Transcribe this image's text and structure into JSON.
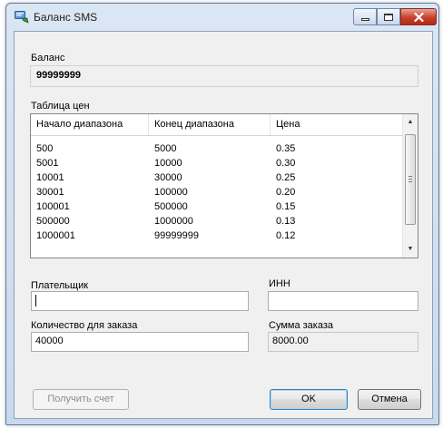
{
  "window": {
    "title": "Баланс SMS"
  },
  "balance": {
    "label": "Баланс",
    "value": "99999999"
  },
  "price_table": {
    "label": "Таблица цен",
    "columns": [
      "Начало диапазона",
      "Конец диапазона",
      "Цена"
    ],
    "rows": [
      [
        "500",
        "5000",
        "0.35"
      ],
      [
        "5001",
        "10000",
        "0.30"
      ],
      [
        "10001",
        "30000",
        "0.25"
      ],
      [
        "30001",
        "100000",
        "0.20"
      ],
      [
        "100001",
        "500000",
        "0.15"
      ],
      [
        "500000",
        "1000000",
        "0.13"
      ],
      [
        "1000001",
        "99999999",
        "0.12"
      ]
    ]
  },
  "payer": {
    "label": "Плательщик",
    "value": ""
  },
  "inn": {
    "label": "ИНН",
    "value": ""
  },
  "quantity": {
    "label": "Количество для заказа",
    "value": "40000"
  },
  "order_sum": {
    "label": "Сумма заказа",
    "value": "8000.00"
  },
  "buttons": {
    "get_invoice": "Получить счет",
    "ok": "OK",
    "cancel": "Отмена"
  },
  "icons": {
    "app": "sms-balance-icon",
    "minimize": "minimize-icon",
    "maximize": "maximize-icon",
    "close": "close-icon"
  }
}
